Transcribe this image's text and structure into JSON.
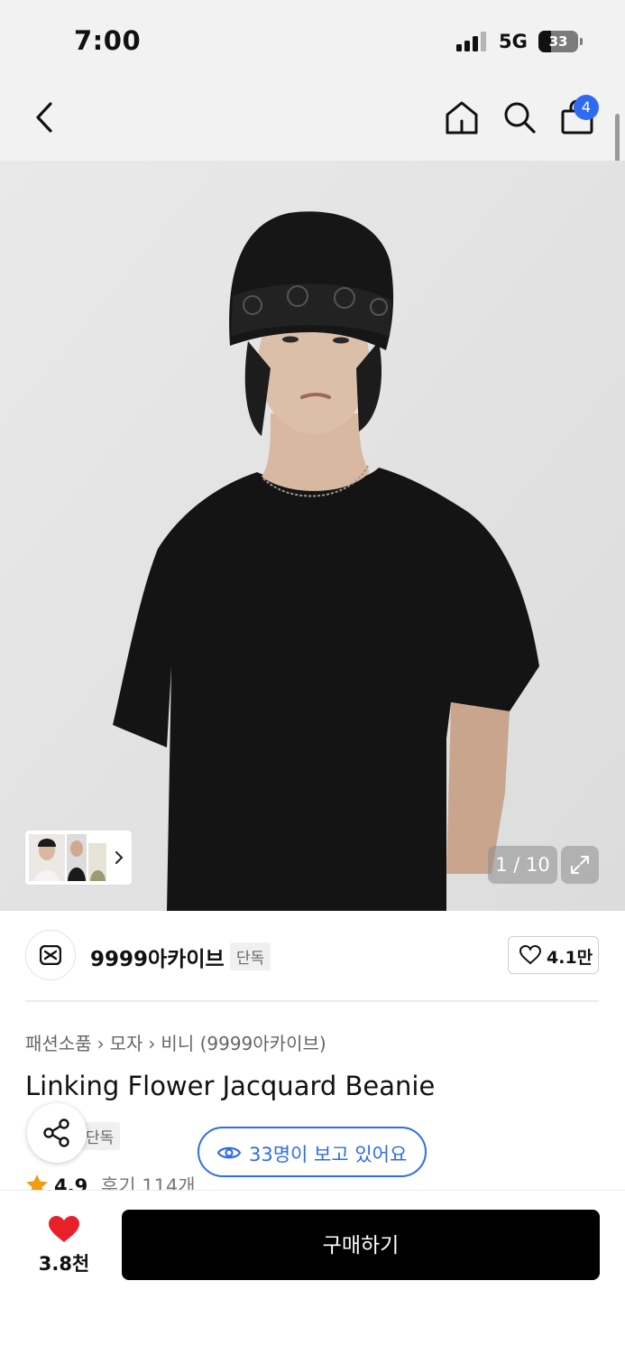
{
  "status_bar": {
    "time": "7:00",
    "network": "5G",
    "battery": "33"
  },
  "header": {
    "cart_count": "4"
  },
  "gallery": {
    "counter": "1 / 10"
  },
  "brand": {
    "name": "9999아카이브",
    "tag": "단독",
    "likes": "4.1만"
  },
  "breadcrumb": {
    "items": [
      "패션소품",
      "모자",
      "비니 (9999아카이브)"
    ]
  },
  "product": {
    "title": "Linking Flower Jacquard Beanie",
    "exclusive_tag": "단독",
    "rating": "4.9",
    "reviews": "후기 114개"
  },
  "viewers": {
    "text": "33명이 보고 있어요"
  },
  "bottom_bar": {
    "heart_count": "3.8천",
    "buy_label": "구매하기"
  },
  "colors": {
    "accent": "#2f6bf0",
    "heart": "#e8202a",
    "star": "#f39c12"
  }
}
